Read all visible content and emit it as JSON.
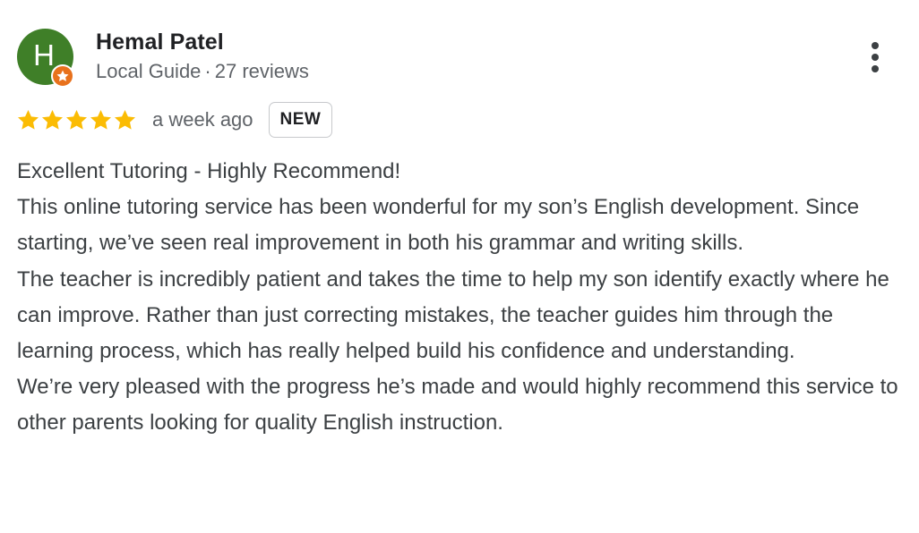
{
  "author": {
    "initial": "H",
    "name": "Hemal Patel",
    "role": "Local Guide",
    "separator": "·",
    "review_count": "27 reviews",
    "avatar_color": "#3f7f28",
    "badge_color": "#e8711c"
  },
  "review": {
    "rating": 5,
    "max_rating": 5,
    "star_color": "#fbbc04",
    "date": "a week ago",
    "badge": "NEW",
    "paragraphs": [
      "Excellent Tutoring - Highly Recommend!",
      "This online tutoring service has been wonderful for my son’s English development. Since starting, we’ve seen real improvement in both his grammar and writing skills.",
      "The teacher is incredibly patient and takes the time to help my son identify exactly where he can improve. Rather than just correcting mistakes, the teacher guides him through the learning process, which has really helped build his confidence and understanding.",
      "We’re very pleased with the progress he’s made and would highly recommend this service to other parents looking for quality English instruction."
    ]
  },
  "icons": {
    "more": "more-vert-icon",
    "guide": "local-guide-star-icon",
    "star": "star-icon"
  }
}
